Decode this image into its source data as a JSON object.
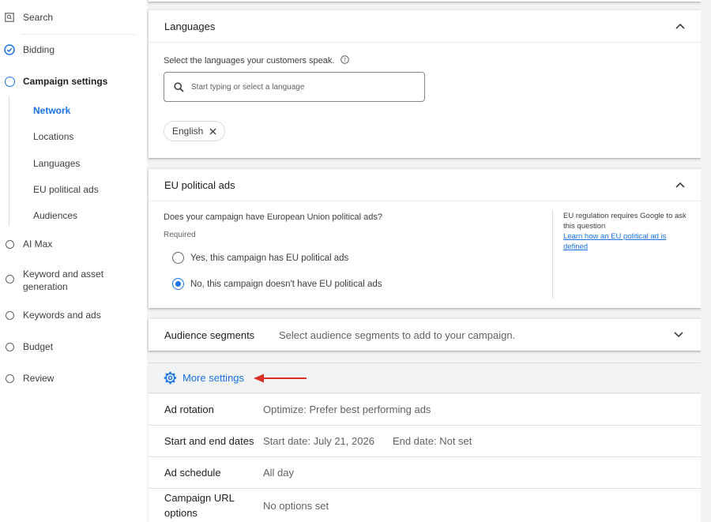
{
  "nav": {
    "steps": [
      {
        "label": "Search",
        "state": "icon"
      },
      {
        "label": "Bidding",
        "state": "done"
      },
      {
        "label": "Campaign settings",
        "state": "current"
      },
      {
        "label": "AI Max",
        "state": "todo"
      },
      {
        "label": "Keyword and asset generation",
        "state": "todo"
      },
      {
        "label": "Keywords and ads",
        "state": "todo"
      },
      {
        "label": "Budget",
        "state": "todo"
      },
      {
        "label": "Review",
        "state": "todo"
      }
    ],
    "subitems": [
      "Network",
      "Locations",
      "Languages",
      "EU political ads",
      "Audiences"
    ],
    "active_sub": "Network"
  },
  "languages": {
    "title": "Languages",
    "prompt": "Select the languages your customers speak.",
    "search_placeholder": "Start typing or select a language",
    "chip": "English"
  },
  "eu": {
    "title": "EU political ads",
    "question": "Does your campaign have European Union political ads?",
    "required": "Required",
    "option_yes": "Yes, this campaign has EU political ads",
    "option_no": "No, this campaign doesn't have EU political ads",
    "selected": "no",
    "aside_text": "EU regulation requires Google to ask this question",
    "aside_link": "Learn how an EU political ad is defined"
  },
  "audience": {
    "title": "Audience segments",
    "desc": "Select audience segments to add to your campaign."
  },
  "more_settings": "More settings",
  "settings": {
    "ad_rotation": {
      "label": "Ad rotation",
      "value": "Optimize: Prefer best performing ads"
    },
    "dates": {
      "label": "Start and end dates",
      "start": "Start date: July 21, 2026",
      "end": "End date: Not set"
    },
    "schedule": {
      "label": "Ad schedule",
      "value": "All day"
    },
    "url": {
      "label_line1": "Campaign URL",
      "label_line2": "options",
      "value": "No options set"
    }
  },
  "colors": {
    "accent": "#1a73e8",
    "arrow": "#d93025"
  }
}
